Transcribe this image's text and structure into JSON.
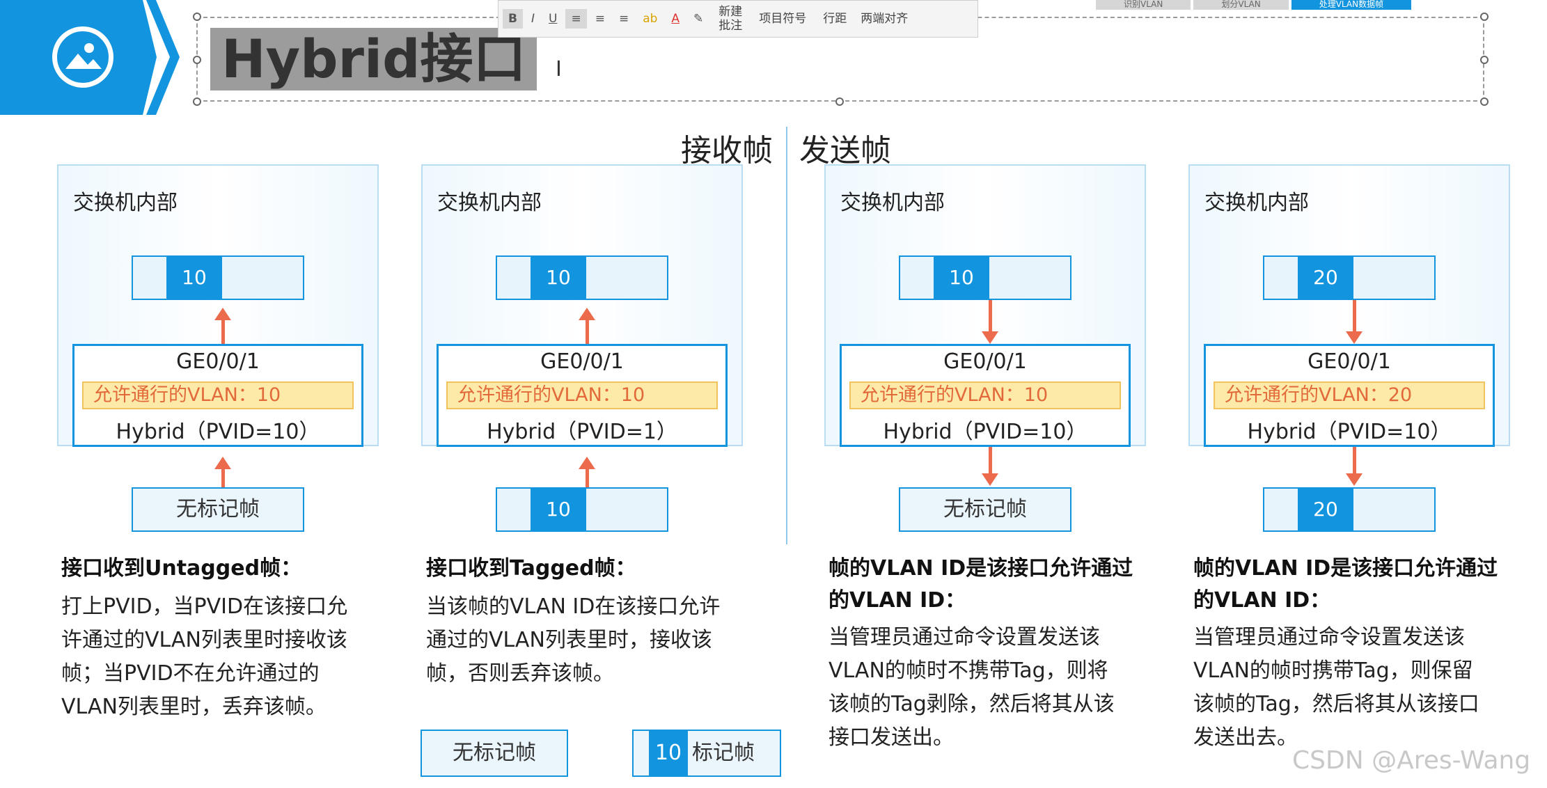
{
  "header": {
    "title": "Hybrid接口",
    "breadcrumbs": [
      "识别VLAN",
      "划分VLAN",
      "处理VLAN数据帧"
    ],
    "toolbar": {
      "bold": "B",
      "italic": "I",
      "underline": "U",
      "font_color": "A",
      "new_comment": "新建",
      "comment": "批注",
      "bullets": "项目符号",
      "line_spacing": "行距",
      "justify": "两端对齐"
    }
  },
  "headings": {
    "receive": "接收帧",
    "send": "发送帧"
  },
  "panels": [
    {
      "label": "交换机内部",
      "top_tag": "10",
      "port": "GE0/0/1",
      "allowed": "允许通行的VLAN：10",
      "mode": "Hybrid（PVID=10）",
      "bottom_text": "无标记帧",
      "bottom_tag": "",
      "desc_title": [
        "接口收到Untagged帧："
      ],
      "desc_body": [
        "打上PVID，当PVID在该接口允",
        "许通过的VLAN列表里时接收该",
        "帧；当PVID不在允许通过的",
        "VLAN列表里时，丢弃该帧。"
      ]
    },
    {
      "label": "交换机内部",
      "top_tag": "10",
      "port": "GE0/0/1",
      "allowed": "允许通行的VLAN：10",
      "mode": "Hybrid（PVID=1）",
      "bottom_text": "",
      "bottom_tag": "10",
      "desc_title": [
        "接口收到Tagged帧："
      ],
      "desc_body": [
        "当该帧的VLAN ID在该接口允许",
        "通过的VLAN列表里时，接收该",
        "帧，否则丢弃该帧。"
      ]
    },
    {
      "label": "交换机内部",
      "top_tag": "10",
      "port": "GE0/0/1",
      "allowed": "允许通行的VLAN：10",
      "mode": "Hybrid（PVID=10）",
      "bottom_text": "无标记帧",
      "bottom_tag": "",
      "desc_title": [
        "帧的VLAN ID是该接口允许通过",
        "的VLAN ID："
      ],
      "desc_body": [
        "当管理员通过命令设置发送该",
        "VLAN的帧时不携带Tag，则将",
        "该帧的Tag剥除，然后将其从该",
        "接口发送出。"
      ]
    },
    {
      "label": "交换机内部",
      "top_tag": "20",
      "port": "GE0/0/1",
      "allowed": "允许通行的VLAN：20",
      "mode": "Hybrid（PVID=10）",
      "bottom_text": "",
      "bottom_tag": "20",
      "desc_title": [
        "帧的VLAN ID是该接口允许通过",
        "的VLAN ID："
      ],
      "desc_body": [
        "当管理员通过命令设置发送该",
        "VLAN的帧时携带Tag，则保留",
        "该帧的Tag，然后将其从该接口",
        "发送出去。"
      ]
    }
  ],
  "legend": {
    "untagged": "无标记帧",
    "tag": "10",
    "tagged": "标记帧"
  },
  "watermark": "CSDN @Ares-Wang"
}
